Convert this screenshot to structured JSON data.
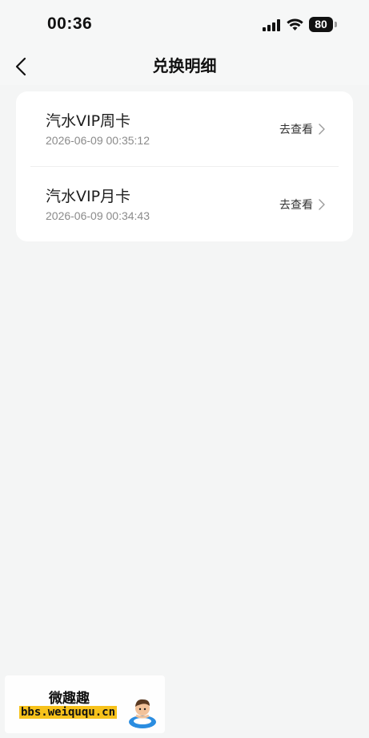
{
  "status_bar": {
    "time": "00:36",
    "battery": "80"
  },
  "nav": {
    "title": "兑换明细"
  },
  "records": [
    {
      "name": "汽水VIP周卡",
      "time": "2026-06-09 00:35:12",
      "action": "去查看"
    },
    {
      "name": "汽水VIP月卡",
      "time": "2026-06-09 00:34:43",
      "action": "去查看"
    }
  ],
  "watermark": {
    "title": "微趣趣",
    "url": "bbs.weiququ.cn"
  },
  "colors": {
    "background": "#f4f5f5",
    "card": "#ffffff",
    "text_primary": "#1d1d1d",
    "text_secondary": "#8b8b8b",
    "watermark_highlight": "#f7c21b"
  },
  "icons": [
    "signal-icon",
    "wifi-icon",
    "battery-icon",
    "back-arrow-icon",
    "chevron-right-icon",
    "mascot-icon"
  ]
}
